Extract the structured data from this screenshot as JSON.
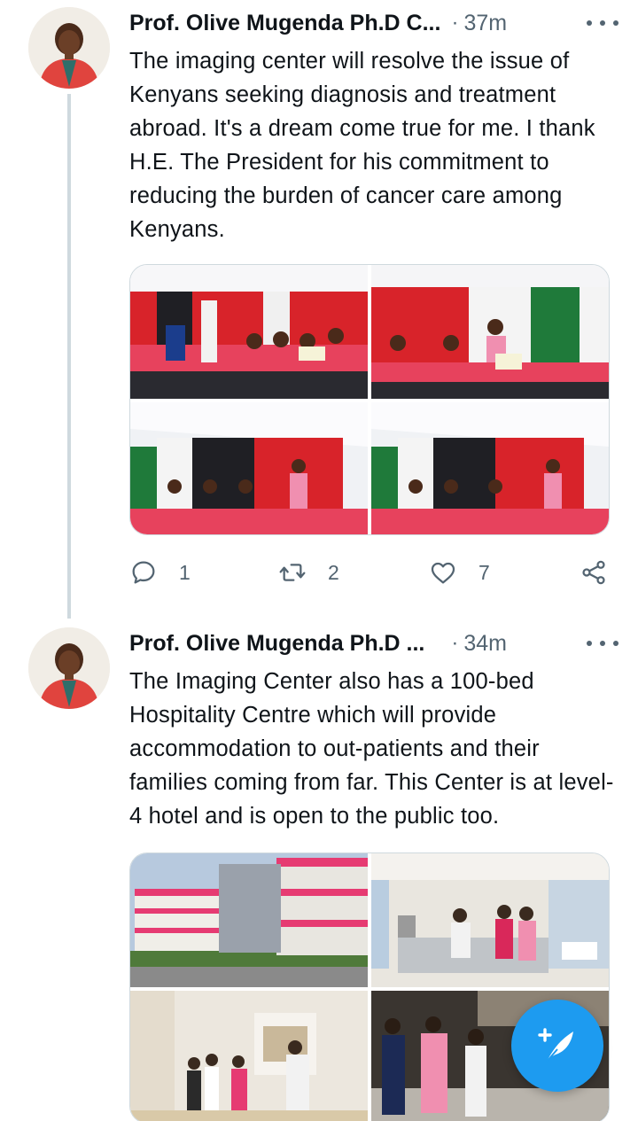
{
  "tweets": [
    {
      "author": "Prof. Olive Mugenda Ph.D C...",
      "separator": "·",
      "time": "37m",
      "text": "The imaging center will resolve the issue of Kenyans seeking diagnosis and treatment abroad. It's a dream come true for me. I thank H.E. The President for his commitment to reducing the burden of cancer care among Kenyans.",
      "replies": "1",
      "retweets": "2",
      "likes": "7"
    },
    {
      "author": "Prof. Olive Mugenda Ph.D ...",
      "separator": "·",
      "time": "34m",
      "text": "The Imaging Center also has a 100-bed Hospitality Centre which will provide accommodation to out-patients and their families coming from far. This Center is at level-4 hotel and is open to the public too."
    }
  ],
  "icons": {
    "more": "more-horizontal-icon",
    "reply": "reply-icon",
    "retweet": "retweet-icon",
    "like": "heart-icon",
    "share": "share-icon",
    "compose": "compose-tweet-icon"
  },
  "colors": {
    "accent": "#1d9bf0",
    "text_primary": "#0f1419",
    "text_secondary": "#536471",
    "divider": "#cfd9de"
  }
}
